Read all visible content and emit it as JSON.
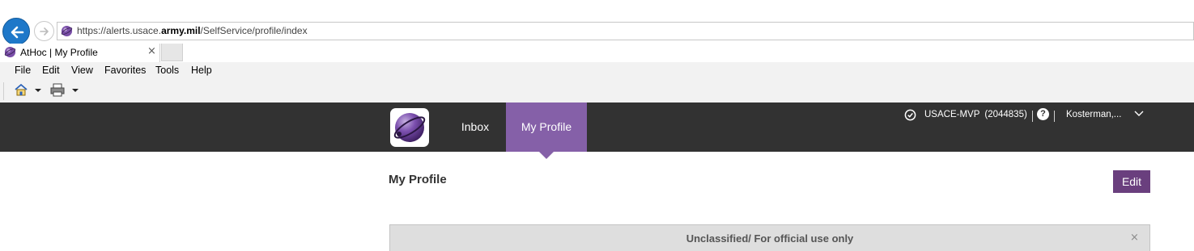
{
  "browser": {
    "url_prefix": "https://alerts.usace.",
    "url_domain": "army.mil",
    "url_path": "/SelfService/profile/index",
    "tab_title": "AtHoc | My Profile",
    "tab_close": "×",
    "menu": [
      "File",
      "Edit",
      "View",
      "Favorites",
      "Tools",
      "Help"
    ]
  },
  "app": {
    "nav": {
      "inbox": "Inbox",
      "my_profile": "My Profile"
    },
    "org_name": "USACE-MVP",
    "org_id": "(2044835)",
    "help": "?",
    "user": "Kosterman,..."
  },
  "page": {
    "title": "My Profile",
    "edit": "Edit",
    "banner": "Unclassified/ For official use only",
    "banner_close": "×"
  },
  "colors": {
    "nav_bg": "#323232",
    "nav_active": "#8560a8",
    "edit_button": "#6a3f7e",
    "banner_bg": "#dedede"
  }
}
